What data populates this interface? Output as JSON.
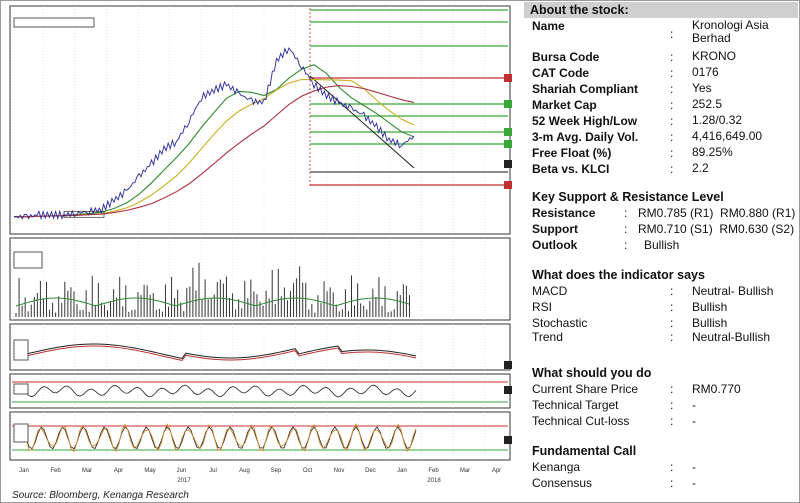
{
  "about": {
    "header": "About the stock:",
    "fields": [
      {
        "label": "Name",
        "value": "Kronologi Asia Berhad"
      },
      {
        "label": "Bursa Code",
        "value": "KRONO"
      },
      {
        "label": "CAT Code",
        "value": "0176"
      },
      {
        "label": "Shariah Compliant",
        "value": "Yes"
      },
      {
        "label": "Market Cap",
        "value": "252.5"
      },
      {
        "label": "52 Week High/Low",
        "value": "1.28/0.32"
      },
      {
        "label": "3-m Avg. Daily Vol.",
        "value": "4,416,649.00"
      },
      {
        "label": "Free Float (%)",
        "value": "89.25%"
      },
      {
        "label": "Beta vs. KLCI",
        "value": "2.2"
      }
    ]
  },
  "levels": {
    "title": "Key Support & Resistance Level",
    "resistance_label": "Resistance",
    "resistance_value": "RM0.785 (R1)  RM0.880 (R1)",
    "support_label": "Support",
    "support_value": "RM0.710 (S1)  RM0.630 (S2)",
    "outlook_label": "Outlook",
    "outlook_value": "Bullish"
  },
  "indicators": {
    "title": "What does the indicator says",
    "items": [
      {
        "label": "MACD",
        "value": "Neutral- Bullish"
      },
      {
        "label": "RSI",
        "value": "Bullish"
      },
      {
        "label": "Stochastic",
        "value": "Bullish"
      },
      {
        "label": "Trend",
        "value": "Neutral-Bullish"
      }
    ]
  },
  "todo": {
    "title": "What should you do",
    "items": [
      {
        "label": "Current Share Price",
        "value": "RM0.770"
      },
      {
        "label": "Technical Target",
        "value": "-"
      },
      {
        "label": "Technical Cut-loss",
        "value": "-"
      }
    ]
  },
  "fundamental": {
    "title": "Fundamental Call",
    "items": [
      {
        "label": "Kenanga",
        "value": "-"
      },
      {
        "label": "Consensus",
        "value": "-"
      }
    ]
  },
  "source": "Source: Bloomberg, Kenanga Research",
  "chart_data": {
    "type": "line",
    "months": [
      "Jan",
      "Feb",
      "Mar",
      "Apr",
      "May",
      "Jun",
      "Jul",
      "Aug",
      "Sep",
      "Oct",
      "Nov",
      "Dec",
      "Jan",
      "Feb",
      "Mar",
      "Apr"
    ],
    "years": [
      "2017",
      "2018"
    ],
    "price": [
      0.33,
      0.33,
      0.34,
      0.34,
      0.34,
      0.35,
      0.36,
      0.37,
      0.42,
      0.47,
      0.55,
      0.62,
      0.7,
      0.74,
      0.85,
      0.98,
      1.02,
      1.05,
      1.0,
      0.96,
      0.95,
      1.18,
      1.25,
      1.15,
      1.05,
      0.99,
      0.95,
      0.92,
      0.88,
      0.82,
      0.75,
      0.72,
      0.77
    ],
    "colors": {
      "price": "#2a2a9a",
      "ma_fast": "#2e8b2e",
      "ma_mid": "#c8b020",
      "ma_slow": "#b03040",
      "fib": "#3aa63a",
      "res": "#c03030"
    }
  }
}
